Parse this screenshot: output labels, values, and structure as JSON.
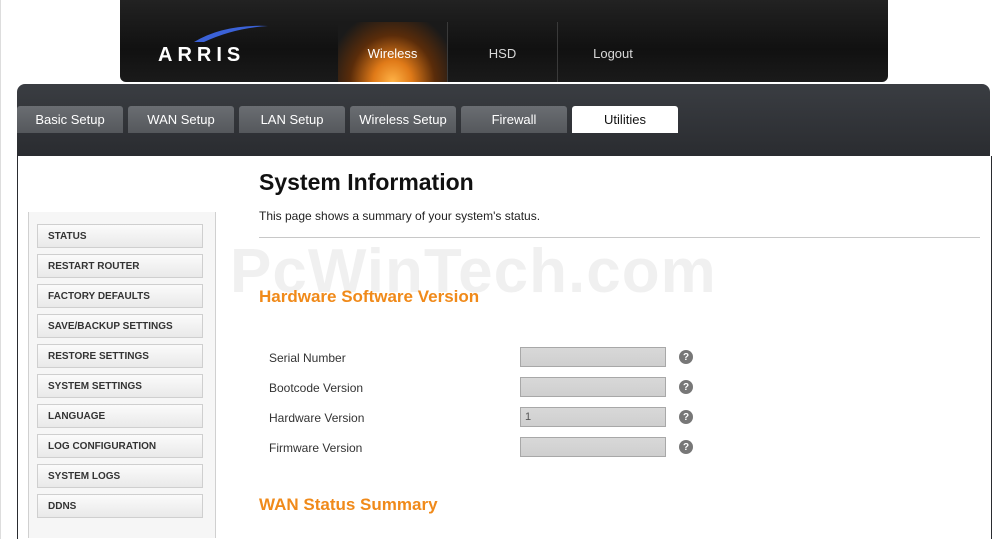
{
  "brand": "ARRIS",
  "topnav": [
    "Wireless",
    "HSD",
    "Logout"
  ],
  "tabs": [
    "Basic Setup",
    "WAN Setup",
    "LAN Setup",
    "Wireless Setup",
    "Firewall",
    "Utilities"
  ],
  "active_tab": "Utilities",
  "menu": [
    "STATUS",
    "RESTART ROUTER",
    "FACTORY DEFAULTS",
    "SAVE/BACKUP SETTINGS",
    "RESTORE SETTINGS",
    "SYSTEM SETTINGS",
    "LANGUAGE",
    "LOG CONFIGURATION",
    "SYSTEM LOGS",
    "DDNS"
  ],
  "page": {
    "title": "System Information",
    "description": "This page shows a summary of your system's status.",
    "watermark": "PcWinTech.com"
  },
  "sections": {
    "hardware": "Hardware Software Version",
    "wan": "WAN Status Summary"
  },
  "fields": [
    {
      "label": "Serial Number",
      "value": ""
    },
    {
      "label": "Bootcode Version",
      "value": ""
    },
    {
      "label": "Hardware Version",
      "value": "1"
    },
    {
      "label": "Firmware Version",
      "value": ""
    }
  ],
  "help_glyph": "?",
  "colors": {
    "accent": "#f08a1a",
    "header": "#1a1a1a",
    "band": "#2f3236"
  }
}
